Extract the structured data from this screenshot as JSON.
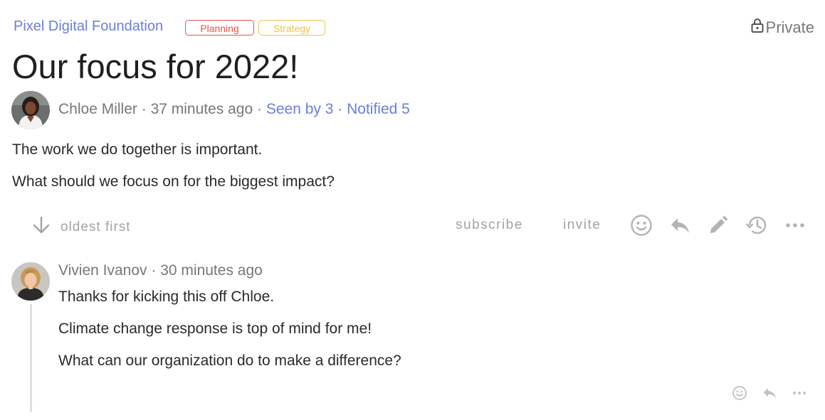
{
  "header": {
    "organization": "Pixel Digital Foundation",
    "tags": [
      {
        "label": "Planning",
        "color": "#e35454"
      },
      {
        "label": "Strategy",
        "color": "#f1c24a"
      }
    ],
    "privacy_label": "Private",
    "privacy_icon": "lock-icon"
  },
  "post": {
    "title": "Our focus for 2022!",
    "author": "Chloe Miller",
    "time": "37 minutes ago",
    "separator": "·",
    "seen": "Seen by 3",
    "notified": "Notified 5",
    "paragraphs": [
      "The work we do together is important.",
      "What should we focus on for the biggest impact?"
    ]
  },
  "toolbar": {
    "sort_label": "oldest first",
    "sort_icon": "arrow-down-icon",
    "subscribe_label": "subscribe",
    "invite_label": "invite",
    "icons": [
      "smiley-icon",
      "reply-icon",
      "edit-icon",
      "history-icon",
      "more-icon"
    ]
  },
  "reply": {
    "author": "Vivien Ivanov",
    "time": "30 minutes ago",
    "separator": "·",
    "paragraphs": [
      "Thanks for kicking this off Chloe.",
      "Climate change response is top of mind for me!",
      "What can our organization do to make a difference?"
    ],
    "icons": [
      "smiley-icon",
      "reply-icon",
      "more-icon"
    ]
  },
  "colors": {
    "link": "#6a7fd8",
    "muted": "#a3a3a3",
    "text": "#2a2a2a"
  }
}
